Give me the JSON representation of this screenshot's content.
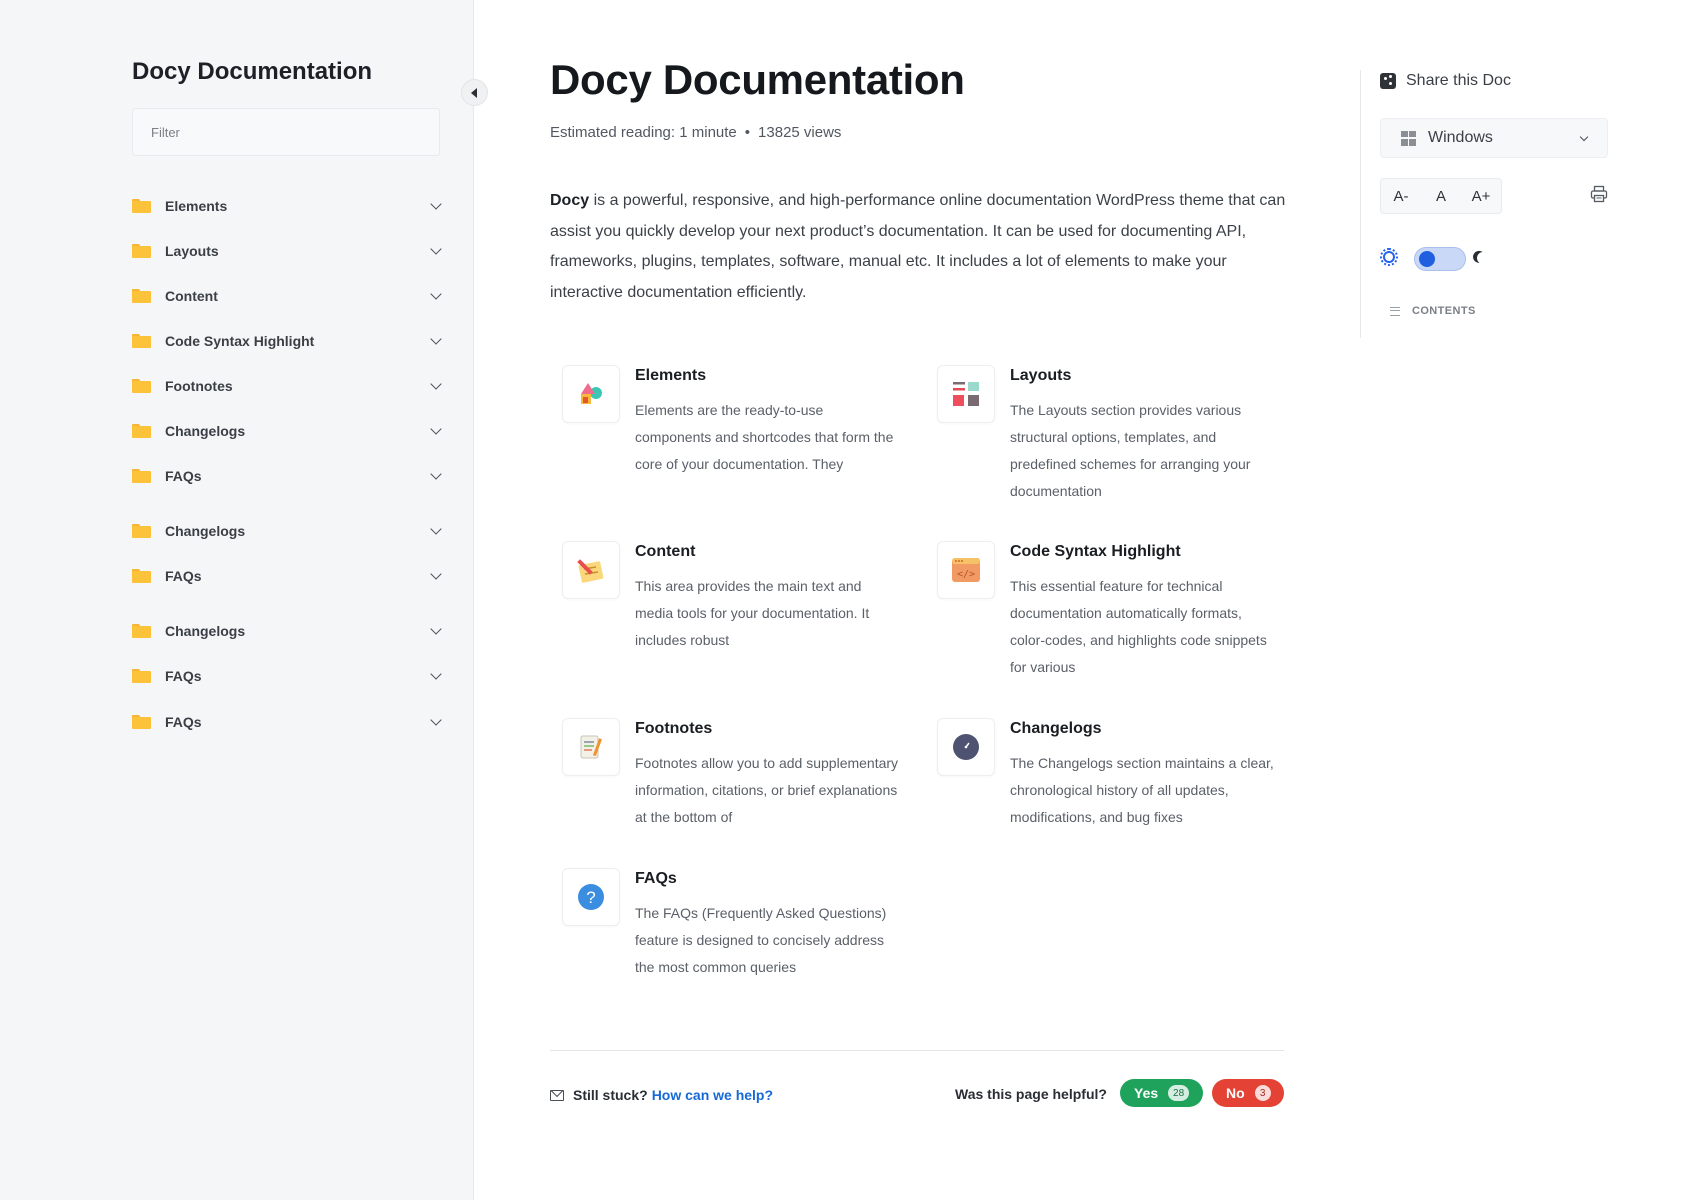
{
  "sidebar": {
    "title": "Docy Documentation",
    "filter_placeholder": "Filter",
    "items": [
      {
        "label": "Elements"
      },
      {
        "label": "Layouts"
      },
      {
        "label": "Content"
      },
      {
        "label": "Code Syntax Highlight"
      },
      {
        "label": "Footnotes"
      },
      {
        "label": "Changelogs"
      },
      {
        "label": "FAQs"
      },
      {
        "label": "Changelogs"
      },
      {
        "label": "FAQs"
      },
      {
        "label": "Changelogs"
      },
      {
        "label": "FAQs"
      },
      {
        "label": "FAQs"
      }
    ]
  },
  "main": {
    "title": "Docy Documentation",
    "meta": {
      "reading": "Estimated reading: 1 minute",
      "separator": "•",
      "views": "13825 views"
    },
    "intro": {
      "brand": "Docy",
      "text": " is a powerful, responsive, and high-performance online documentation WordPress theme that can assist you quickly develop your next product’s documentation. It can be used for documenting API, frameworks, plugins, templates, software, manual etc. It includes a lot of elements to make your interactive documentation efficiently."
    },
    "cards": [
      {
        "title": "Elements",
        "desc": "Elements are the ready-to-use components and shortcodes that form the core of your documentation. They",
        "icon": "shapes-icon"
      },
      {
        "title": "Layouts",
        "desc": "The Layouts section provides various structural options, templates, and predefined schemes for arranging your documentation",
        "icon": "layout-icon"
      },
      {
        "title": "Content",
        "desc": "This area provides the main text and media tools for your documentation. It includes robust",
        "icon": "note-pencil-icon"
      },
      {
        "title": "Code Syntax Highlight",
        "desc": "This essential feature for technical documentation automatically formats, color-codes, and highlights code snippets for various",
        "icon": "code-window-icon"
      },
      {
        "title": "Footnotes",
        "desc": "Footnotes allow you to add supplementary information, citations, or brief explanations at the bottom of",
        "icon": "notepad-icon"
      },
      {
        "title": "Changelogs",
        "desc": "The Changelogs section maintains a clear, chronological history of all updates, modifications, and bug fixes",
        "icon": "clock-icon"
      },
      {
        "title": "FAQs",
        "desc": "The FAQs (Frequently Asked Questions) feature is designed to concisely address the most common queries",
        "icon": "question-icon"
      }
    ],
    "footer": {
      "stuck": "Still stuck?",
      "help_link": "How can we help?",
      "helpful": "Was this page helpful?",
      "yes_label": "Yes",
      "yes_count": "28",
      "no_label": "No",
      "no_count": "3"
    }
  },
  "right_panel": {
    "share": "Share this Doc",
    "os_selected": "Windows",
    "font_buttons": [
      "A-",
      "A",
      "A+"
    ],
    "contents_label": "CONTENTS"
  },
  "colors": {
    "accent_blue": "#1769d6",
    "yes_green": "#1fa35c",
    "no_red": "#e34234",
    "folder_yellow": "#fcc23a"
  }
}
